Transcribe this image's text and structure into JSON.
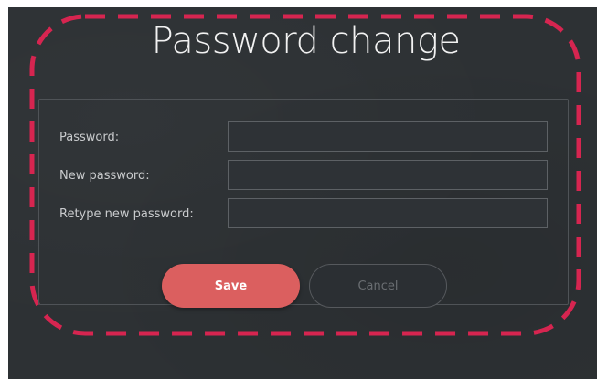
{
  "dialog": {
    "title": "Password change"
  },
  "form": {
    "password_label": "Password:",
    "new_password_label": "New password:",
    "retype_label": "Retype new password:",
    "password_value": "",
    "new_password_value": "",
    "retype_value": ""
  },
  "actions": {
    "save_label": "Save",
    "cancel_label": "Cancel"
  },
  "colors": {
    "background": "#2d3134",
    "accent": "#db5f5f",
    "highlight_frame": "#d62550"
  }
}
